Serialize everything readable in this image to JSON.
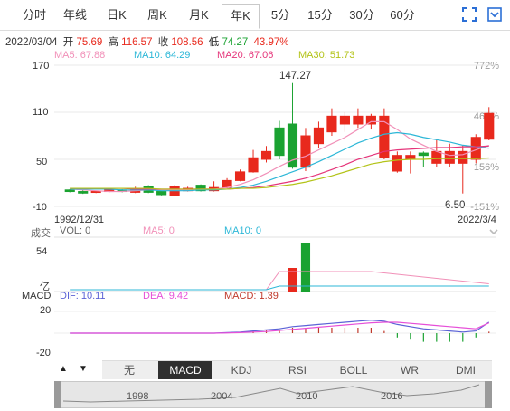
{
  "tabs": [
    "分时",
    "年线",
    "日K",
    "周K",
    "月K",
    "年K",
    "5分",
    "15分",
    "30分",
    "60分"
  ],
  "active_tab": "年K",
  "info": {
    "date": "2022/03/04",
    "open_label": "开",
    "open": "75.69",
    "high_label": "高",
    "high": "116.57",
    "close_label": "收",
    "close": "108.56",
    "low_label": "低",
    "low": "74.27",
    "change": "43.97%"
  },
  "ma": {
    "ma5": "MA5: 67.88",
    "ma10": "MA10: 64.29",
    "ma20": "MA20: 67.06",
    "ma30": "MA30: 51.73"
  },
  "price_axis": [
    "170",
    "110",
    "50",
    "-10"
  ],
  "pct_axis": [
    "772%",
    "461%",
    "156%",
    "-151%"
  ],
  "annotations": {
    "max": "147.27",
    "min": "6.50"
  },
  "date_start": "1992/12/31",
  "date_end": "2022/3/4",
  "volume": {
    "title": "成交",
    "vol": "VOL: 0",
    "ma5": "MA5: 0",
    "ma10": "MA10: 0",
    "top": "54",
    "unit": "亿"
  },
  "macd": {
    "title": "MACD",
    "dif": "DIF: 10.11",
    "dea": "DEA: 9.42",
    "macd": "MACD: 1.39",
    "top": "20",
    "bottom": "-20"
  },
  "indicators": [
    "无",
    "MACD",
    "KDJ",
    "RSI",
    "BOLL",
    "WR",
    "DMI"
  ],
  "active_indicator": "MACD",
  "nav_years": [
    "1998",
    "2004",
    "2010",
    "2016"
  ],
  "colors": {
    "up": "#e8291d",
    "down": "#1aa231",
    "ma5": "#f190b8",
    "ma10": "#2cb7d7",
    "ma20": "#e5357a",
    "ma30": "#b3c318",
    "dif": "#5b62d6",
    "dea": "#e64fd8"
  },
  "chart_data": {
    "type": "candlestick",
    "periods": 30,
    "candles": [
      {
        "o": 11,
        "c": 9,
        "h": 12,
        "l": 8
      },
      {
        "o": 9,
        "c": 7,
        "h": 11,
        "l": 6
      },
      {
        "o": 8,
        "c": 9,
        "h": 10,
        "l": 7
      },
      {
        "o": 9,
        "c": 11,
        "h": 12,
        "l": 8
      },
      {
        "o": 11,
        "c": 9,
        "h": 12,
        "l": 8
      },
      {
        "o": 8,
        "c": 13,
        "h": 15,
        "l": 7
      },
      {
        "o": 15,
        "c": 8,
        "h": 17,
        "l": 7
      },
      {
        "o": 9,
        "c": 5,
        "h": 10,
        "l": 4
      },
      {
        "o": 4,
        "c": 15,
        "h": 17,
        "l": 3
      },
      {
        "o": 10,
        "c": 13,
        "h": 15,
        "l": 9
      },
      {
        "o": 17,
        "c": 10,
        "h": 18,
        "l": 9
      },
      {
        "o": 10,
        "c": 14,
        "h": 22,
        "l": 9
      },
      {
        "o": 14,
        "c": 23,
        "h": 26,
        "l": 13
      },
      {
        "o": 23,
        "c": 34,
        "h": 37,
        "l": 22
      },
      {
        "o": 34,
        "c": 52,
        "h": 62,
        "l": 33
      },
      {
        "o": 50,
        "c": 60,
        "h": 67,
        "l": 46
      },
      {
        "o": 90,
        "c": 55,
        "h": 99,
        "l": 50
      },
      {
        "o": 95,
        "c": 40,
        "h": 147.27,
        "l": 38
      },
      {
        "o": 40,
        "c": 80,
        "h": 90,
        "l": 35
      },
      {
        "o": 70,
        "c": 90,
        "h": 98,
        "l": 65
      },
      {
        "o": 85,
        "c": 105,
        "h": 115,
        "l": 80
      },
      {
        "o": 95,
        "c": 105,
        "h": 110,
        "l": 85
      },
      {
        "o": 95,
        "c": 105,
        "h": 115,
        "l": 90
      },
      {
        "o": 95,
        "c": 105,
        "h": 108,
        "l": 88
      },
      {
        "o": 52,
        "c": 105,
        "h": 115,
        "l": 50
      },
      {
        "o": 35,
        "c": 55,
        "h": 60,
        "l": 33
      },
      {
        "o": 50,
        "c": 55,
        "h": 60,
        "l": 32
      },
      {
        "o": 58,
        "c": 55,
        "h": 60,
        "l": 40
      },
      {
        "o": 45,
        "c": 60,
        "h": 75,
        "l": 40
      },
      {
        "o": 45,
        "c": 60,
        "h": 70,
        "l": 40
      },
      {
        "o": 45,
        "c": 60,
        "h": 68,
        "l": 6.5
      },
      {
        "o": 50,
        "c": 78,
        "h": 82,
        "l": 45
      },
      {
        "o": 75.69,
        "c": 108.56,
        "h": 116.57,
        "l": 74.27
      }
    ],
    "ma5": [
      12,
      11,
      10,
      9,
      9,
      10,
      11,
      11,
      11,
      11,
      12,
      12,
      14,
      18,
      24,
      32,
      41,
      49,
      54,
      62,
      70,
      78,
      88,
      98,
      98,
      88,
      76,
      68,
      60,
      55,
      56,
      62,
      67.88
    ],
    "ma10": [
      12,
      12,
      12,
      12,
      11,
      11,
      11,
      10,
      10,
      10,
      11,
      11,
      12,
      14,
      17,
      22,
      28,
      34,
      40,
      47,
      55,
      63,
      71,
      77,
      82,
      84,
      82,
      78,
      75,
      72,
      68,
      66,
      64.29
    ],
    "ma20": [
      13,
      13,
      13,
      13,
      13,
      12,
      12,
      12,
      12,
      12,
      12,
      12,
      12,
      13,
      14,
      16,
      19,
      22,
      26,
      31,
      37,
      43,
      50,
      55,
      60,
      62,
      63,
      64,
      65,
      65,
      66,
      66,
      67.06
    ],
    "ma30": [
      13,
      13,
      13,
      13,
      13,
      13,
      13,
      12,
      12,
      12,
      12,
      12,
      12,
      13,
      13,
      14,
      16,
      18,
      21,
      25,
      29,
      34,
      39,
      44,
      47,
      49,
      50,
      50,
      51,
      51,
      51,
      51,
      51.73
    ],
    "price_range": [
      -10,
      170
    ],
    "volume": [
      0,
      0,
      0,
      0,
      0,
      0,
      0,
      0,
      0,
      0,
      0,
      0,
      0,
      0,
      0,
      0,
      0,
      26,
      54,
      0,
      0,
      0,
      0,
      0,
      0,
      0,
      0,
      0,
      0,
      0,
      0,
      0,
      0
    ],
    "volume_up": [
      false,
      false,
      false,
      false,
      false,
      false,
      false,
      false,
      false,
      false,
      false,
      false,
      false,
      false,
      false,
      false,
      false,
      true,
      false,
      false,
      false,
      false,
      false,
      false,
      false,
      false,
      false,
      false,
      false,
      false,
      false,
      false,
      false
    ],
    "volume_range": [
      0,
      54
    ],
    "dif": [
      0,
      0,
      0,
      0,
      0,
      0,
      0,
      0,
      0,
      0,
      0,
      0,
      0.5,
      1,
      2,
      3,
      4,
      6,
      7,
      8,
      9,
      10,
      11,
      12,
      11,
      8,
      6,
      4,
      3,
      2,
      1,
      2,
      10.11
    ],
    "dea": [
      0,
      0,
      0,
      0,
      0,
      0,
      0,
      0,
      0,
      0,
      0,
      0,
      0.2,
      0.5,
      1,
      1.5,
      2.5,
      3.5,
      4.5,
      5.5,
      6.5,
      7.5,
      8.5,
      9.5,
      10,
      10,
      9,
      8,
      7,
      6,
      5,
      4,
      9.42
    ],
    "macd_bar": [
      0,
      0,
      0,
      0,
      0,
      0,
      0,
      0,
      0,
      0,
      0,
      0,
      0.6,
      1,
      2,
      3,
      3,
      5,
      5,
      5,
      5,
      5,
      5,
      5,
      2,
      -4,
      -6,
      -8,
      -8,
      -8,
      -8,
      -4,
      1.39
    ],
    "macd_range": [
      -20,
      20
    ]
  }
}
